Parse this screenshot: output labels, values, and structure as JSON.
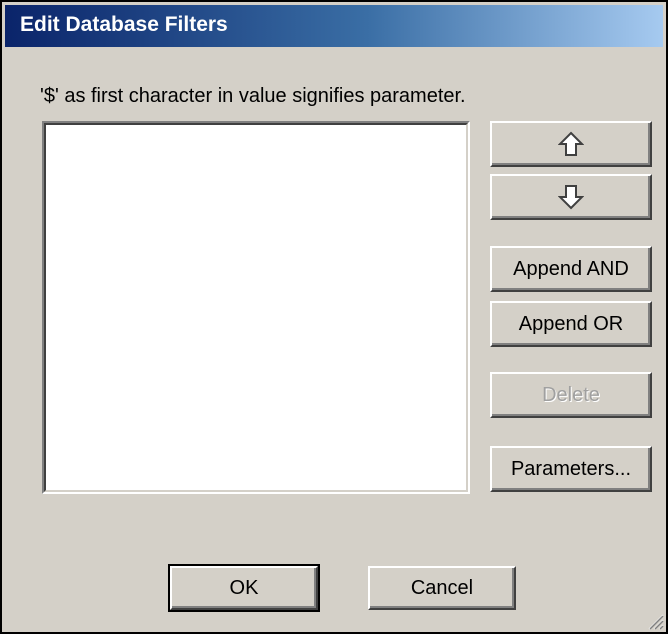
{
  "dialog": {
    "title": "Edit Database Filters",
    "hint": "'$' as first character in value signifies parameter."
  },
  "filter_list": {
    "items": []
  },
  "buttons": {
    "move_up_icon": "up-arrow-icon",
    "move_down_icon": "down-arrow-icon",
    "append_and": "Append AND",
    "append_or": "Append OR",
    "delete": "Delete",
    "parameters": "Parameters...",
    "ok": "OK",
    "cancel": "Cancel"
  },
  "colors": {
    "dialog_bg": "#d4d0c8",
    "title_gradient_start": "#0a246a",
    "title_gradient_end": "#a6caf0",
    "disabled_text": "#a0a0a0"
  }
}
